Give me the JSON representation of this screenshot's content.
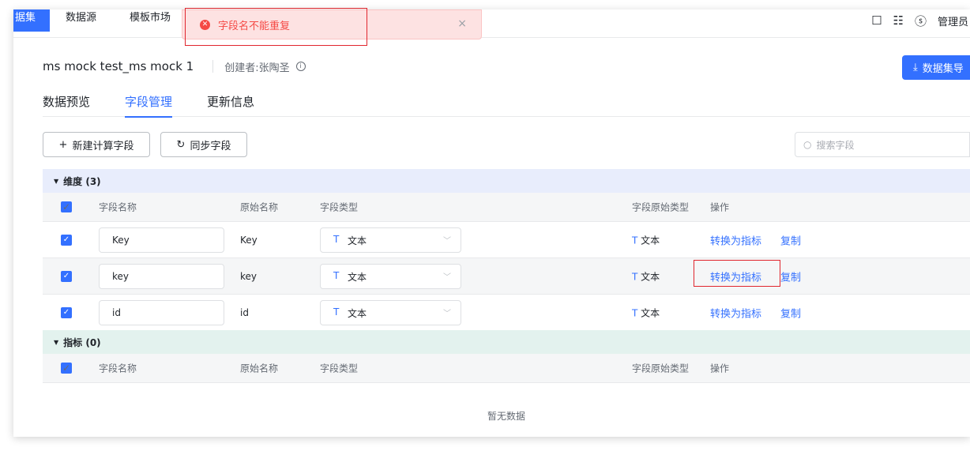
{
  "nav": {
    "active": "据集",
    "items": [
      "数据源",
      "模板市场"
    ],
    "admin": "管理员"
  },
  "toast": {
    "message": "字段名不能重复",
    "close": "×"
  },
  "header": {
    "title": "ms mock test_ms mock 1",
    "creator": "创建者:张陶圣",
    "export_label": "数据集导"
  },
  "tabs": [
    "数据预览",
    "字段管理",
    "更新信息"
  ],
  "actions": {
    "new_calc": "新建计算字段",
    "sync": "同步字段",
    "search_placeholder": "搜索字段"
  },
  "dimension_group": "维度 (3)",
  "metric_group": "指标 (0)",
  "columns": [
    "字段名称",
    "原始名称",
    "字段类型",
    "字段原始类型",
    "操作"
  ],
  "rows": [
    {
      "name": "Key",
      "orig": "Key",
      "type": "文本",
      "orig_type": "文本",
      "op1": "转换为指标",
      "op2": "复制"
    },
    {
      "name": "key",
      "orig": "key",
      "type": "文本",
      "orig_type": "文本",
      "op1": "转换为指标",
      "op2": "复制"
    },
    {
      "name": "id",
      "orig": "id",
      "type": "文本",
      "orig_type": "文本",
      "op1": "转换为指标",
      "op2": "复制"
    }
  ],
  "type_glyph": "T",
  "empty_text": "暂无数据",
  "colors": {
    "accent": "#3370ff",
    "error": "#f54a45",
    "dim_bg": "#e8edfc",
    "metric_bg": "#e3f2ee"
  }
}
